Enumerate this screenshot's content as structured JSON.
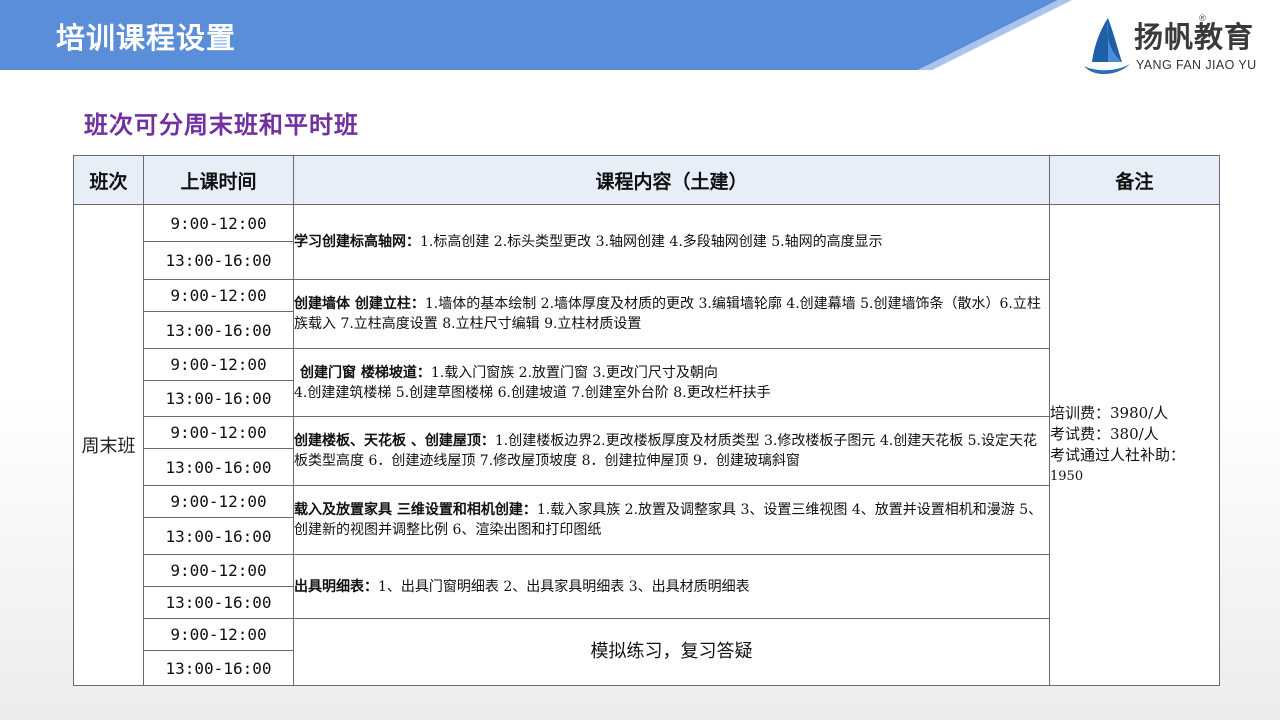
{
  "header": {
    "title": "培训课程设置",
    "subtitle": "班次可分周末班和平时班"
  },
  "logo": {
    "name": "扬帆教育",
    "registered_mark": "®",
    "romanized": "YANG FAN JIAO YU"
  },
  "colors": {
    "banner": "#5b8ed9",
    "subtitle": "#7030a0",
    "header_row": "#e8eef8"
  },
  "table": {
    "headers": [
      "班次",
      "上课时间",
      "课程内容（土建）",
      "备注"
    ],
    "class_name": "周末班",
    "times": [
      "9:00-12:00",
      "13:00-16:00",
      "9:00-12:00",
      "13:00-16:00",
      "9:00-12:00",
      "13:00-16:00",
      "9:00-12:00",
      "13:00-16:00",
      "9:00-12:00",
      "13:00-16:00",
      "9:00-12:00",
      "13:00-16:00",
      "9:00-12:00",
      "13:00-16:00"
    ],
    "modules": [
      {
        "title": "学习创建标高轴网：",
        "body": "1.标高创建 2.标头类型更改 3.轴网创建 4.多段轴网创建 5.轴网的高度显示"
      },
      {
        "title": "创建墙体 创建立柱：",
        "body": "1.墙体的基本绘制 2.墙体厚度及材质的更改 3.编辑墙轮廓 4.创建幕墙 5.创建墙饰条（散水）6.立柱族载入 7.立柱高度设置 8.立柱尺寸编辑 9.立柱材质设置"
      },
      {
        "title": "创建门窗 楼梯坡道：",
        "body": "1.载入门窗族 2.放置门窗 3.更改门尺寸及朝向",
        "body2": "4.创建建筑楼梯 5.创建草图楼梯 6.创建坡道 7.创建室外台阶 8.更改栏杆扶手"
      },
      {
        "title": "创建楼板、天花板 、创建屋顶：",
        "body": "1.创建楼板边界2.更改楼板厚度及材质类型 3.修改楼板子图元 4.创建天花板 5.设定天花板类型高度 6．创建迹线屋顶 7.修改屋顶坡度 8．创建拉伸屋顶 9．创建玻璃斜窗"
      },
      {
        "title": "载入及放置家具 三维设置和相机创建：",
        "body": "1.载入家具族 2.放置及调整家具 3、设置三维视图 4、放置并设置相机和漫游 5、创建新的视图并调整比例 6、渲染出图和打印图纸"
      },
      {
        "title": "出具明细表：",
        "body": "1、出具门窗明细表 2、出具家具明细表 3、出具材质明细表"
      },
      {
        "title": "",
        "body": "模拟练习，复习答疑"
      }
    ],
    "notes": {
      "fee": "培训费：3980/人",
      "exam_fee": "考试费：380/人",
      "subsidy_label": "考试通过人社补助：",
      "subsidy_value": "1950"
    }
  }
}
